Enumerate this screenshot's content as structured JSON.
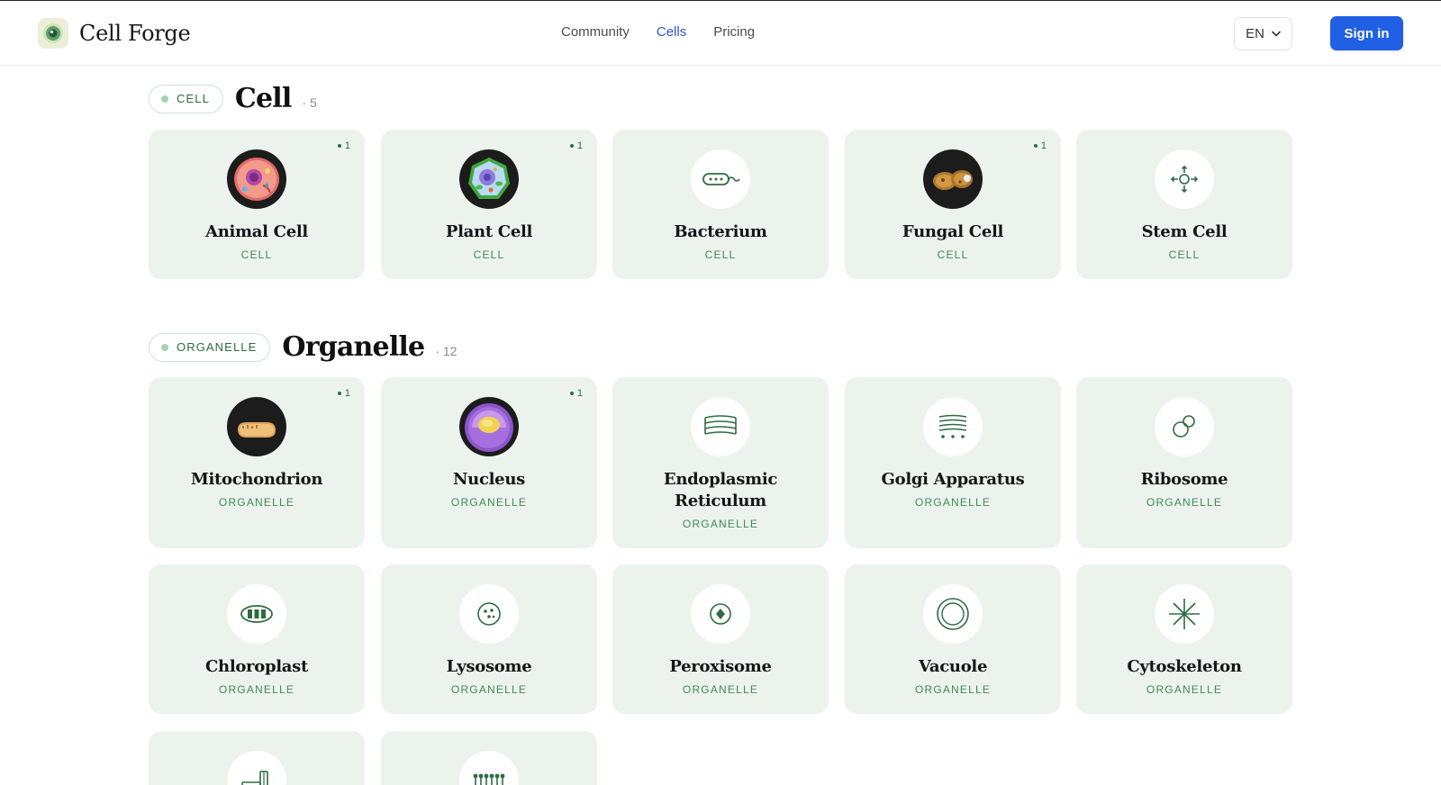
{
  "brand": {
    "name": "Cell Forge"
  },
  "nav": {
    "items": [
      {
        "label": "Community",
        "active": false
      },
      {
        "label": "Cells",
        "active": true
      },
      {
        "label": "Pricing",
        "active": false
      }
    ]
  },
  "language": {
    "value": "EN"
  },
  "auth": {
    "sign_in_label": "Sign in"
  },
  "colors": {
    "accent": "#2160e4",
    "card_bg": "#ebf3ec",
    "green_text": "#3f8a58",
    "nav_active": "#3354c8"
  },
  "sections": [
    {
      "pill": "CELL",
      "title": "Cell",
      "count": "· 5",
      "cards": [
        {
          "name": "Animal Cell",
          "type": "CELL",
          "badge": "1",
          "icon": "animal-cell-image"
        },
        {
          "name": "Plant Cell",
          "type": "CELL",
          "badge": "1",
          "icon": "plant-cell-image"
        },
        {
          "name": "Bacterium",
          "type": "CELL",
          "badge": "",
          "icon": "bacterium-icon"
        },
        {
          "name": "Fungal Cell",
          "type": "CELL",
          "badge": "1",
          "icon": "fungal-cell-image"
        },
        {
          "name": "Stem Cell",
          "type": "CELL",
          "badge": "",
          "icon": "stem-cell-icon"
        }
      ]
    },
    {
      "pill": "ORGANELLE",
      "title": "Organelle",
      "count": "· 12",
      "cards": [
        {
          "name": "Mitochondrion",
          "type": "ORGANELLE",
          "badge": "1",
          "icon": "mitochondrion-image"
        },
        {
          "name": "Nucleus",
          "type": "ORGANELLE",
          "badge": "1",
          "icon": "nucleus-image"
        },
        {
          "name": "Endoplasmic Reticulum",
          "type": "ORGANELLE",
          "badge": "",
          "icon": "er-icon"
        },
        {
          "name": "Golgi Apparatus",
          "type": "ORGANELLE",
          "badge": "",
          "icon": "golgi-icon"
        },
        {
          "name": "Ribosome",
          "type": "ORGANELLE",
          "badge": "",
          "icon": "ribosome-icon"
        },
        {
          "name": "Chloroplast",
          "type": "ORGANELLE",
          "badge": "",
          "icon": "chloroplast-icon"
        },
        {
          "name": "Lysosome",
          "type": "ORGANELLE",
          "badge": "",
          "icon": "lysosome-icon"
        },
        {
          "name": "Peroxisome",
          "type": "ORGANELLE",
          "badge": "",
          "icon": "peroxisome-icon"
        },
        {
          "name": "Vacuole",
          "type": "ORGANELLE",
          "badge": "",
          "icon": "vacuole-icon"
        },
        {
          "name": "Cytoskeleton",
          "type": "ORGANELLE",
          "badge": "",
          "icon": "cytoskeleton-icon"
        },
        {
          "name": "",
          "type": "",
          "badge": "",
          "icon": "membrane-protein-icon"
        },
        {
          "name": "",
          "type": "",
          "badge": "",
          "icon": "phospholipid-icon"
        }
      ]
    }
  ]
}
